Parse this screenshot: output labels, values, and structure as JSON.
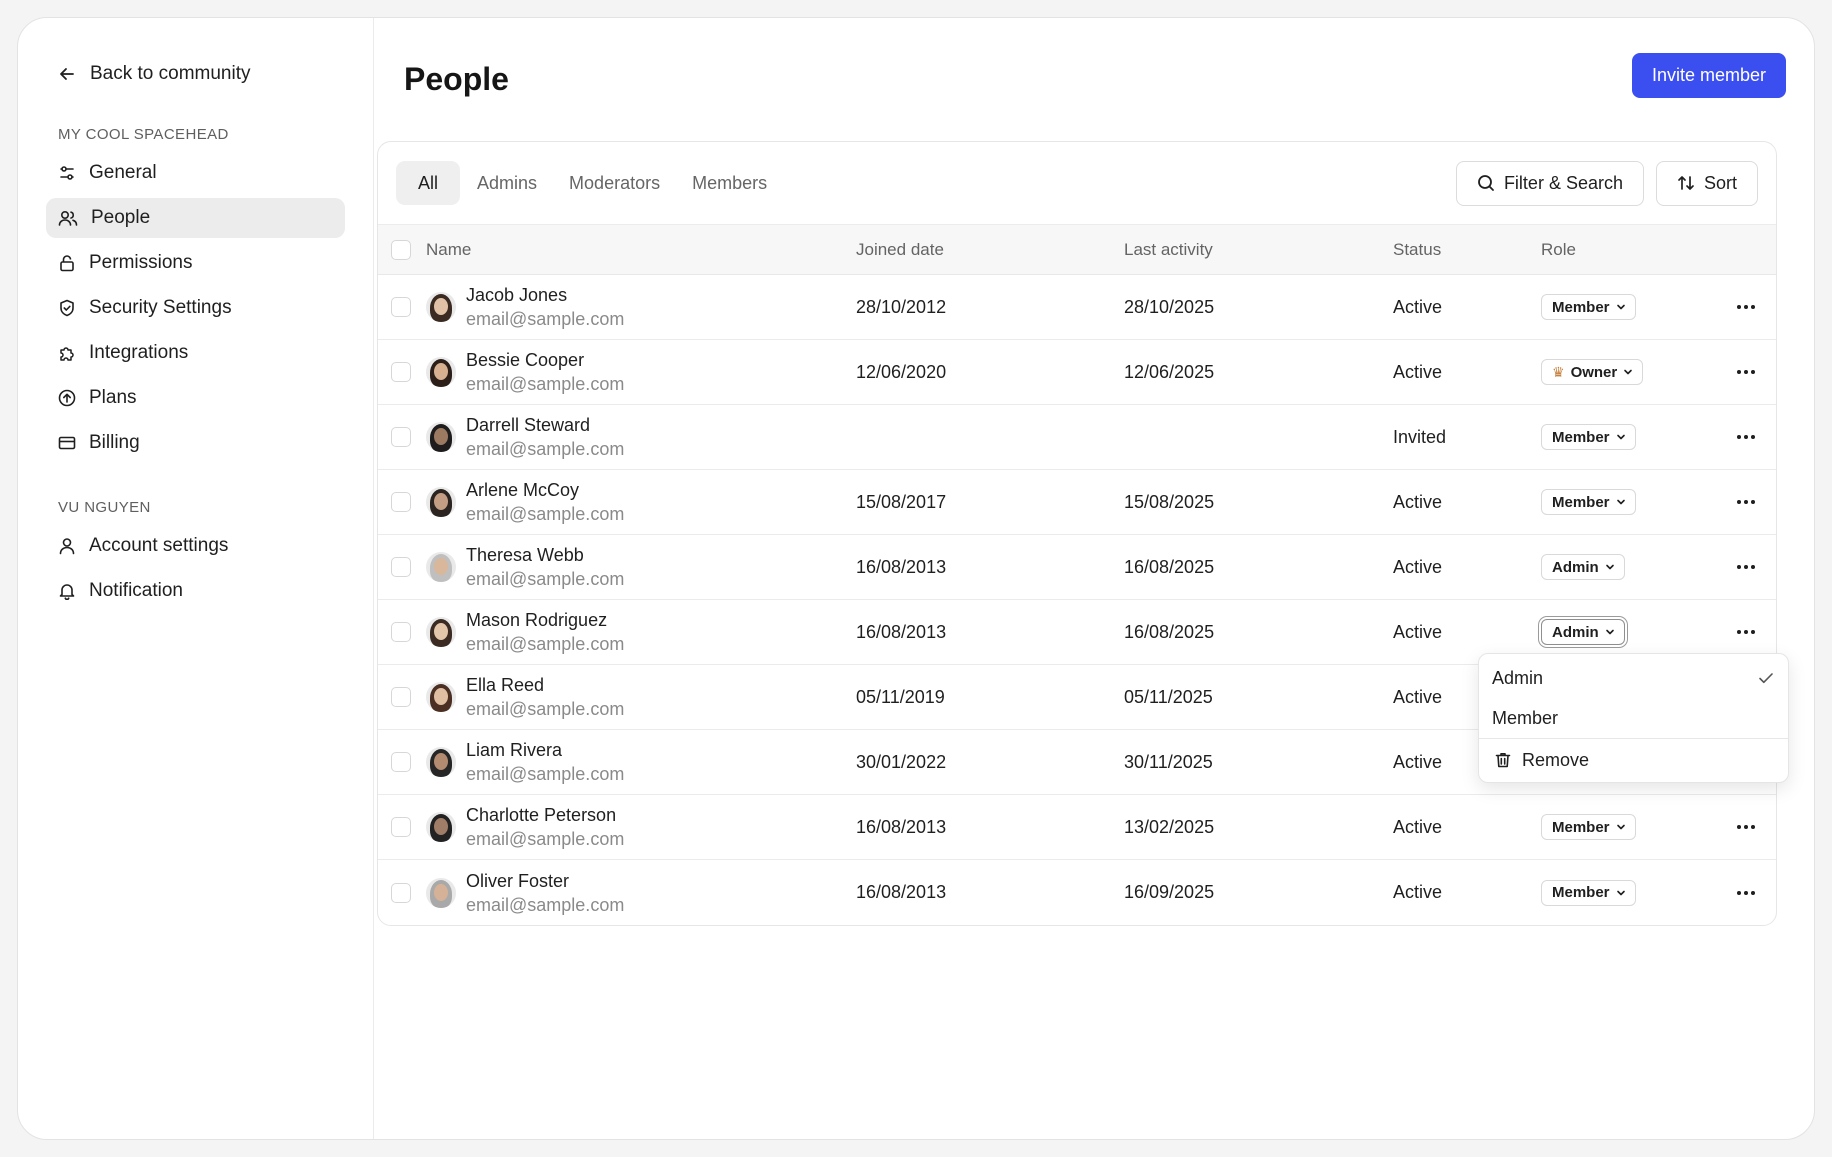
{
  "sidebar": {
    "back_label": "Back to community",
    "section1_title": "MY COOL SPACEHEAD",
    "items": [
      {
        "label": "General",
        "icon": "sliders-icon"
      },
      {
        "label": "People",
        "icon": "people-icon",
        "active": true
      },
      {
        "label": "Permissions",
        "icon": "lock-icon"
      },
      {
        "label": "Security Settings",
        "icon": "shield-icon"
      },
      {
        "label": "Integrations",
        "icon": "puzzle-icon"
      },
      {
        "label": "Plans",
        "icon": "arrow-up-circle-icon"
      },
      {
        "label": "Billing",
        "icon": "credit-card-icon"
      }
    ],
    "section2_title": "VU NGUYEN",
    "items2": [
      {
        "label": "Account settings",
        "icon": "user-icon"
      },
      {
        "label": "Notification",
        "icon": "bell-icon"
      }
    ]
  },
  "header": {
    "title": "People",
    "invite_label": "Invite member"
  },
  "tabs": [
    "All",
    "Admins",
    "Moderators",
    "Members"
  ],
  "toolbar": {
    "filter_label": "Filter & Search",
    "sort_label": "Sort"
  },
  "table": {
    "columns": [
      "Name",
      "Joined date",
      "Last activity",
      "Status",
      "Role"
    ],
    "rows": [
      {
        "name": "Jacob Jones",
        "email": "email@sample.com",
        "joined": "28/10/2012",
        "last": "28/10/2025",
        "status": "Active",
        "role": "Member"
      },
      {
        "name": "Bessie Cooper",
        "email": "email@sample.com",
        "joined": "12/06/2020",
        "last": "12/06/2025",
        "status": "Active",
        "role": "Owner"
      },
      {
        "name": "Darrell Steward",
        "email": "email@sample.com",
        "joined": "",
        "last": "",
        "status": "Invited",
        "role": "Member"
      },
      {
        "name": "Arlene McCoy",
        "email": "email@sample.com",
        "joined": "15/08/2017",
        "last": "15/08/2025",
        "status": "Active",
        "role": "Member"
      },
      {
        "name": "Theresa Webb",
        "email": "email@sample.com",
        "joined": "16/08/2013",
        "last": "16/08/2025",
        "status": "Active",
        "role": "Admin"
      },
      {
        "name": "Mason Rodriguez",
        "email": "email@sample.com",
        "joined": "16/08/2013",
        "last": "16/08/2025",
        "status": "Active",
        "role": "Admin"
      },
      {
        "name": "Ella Reed",
        "email": "email@sample.com",
        "joined": "05/11/2019",
        "last": "05/11/2025",
        "status": "Active",
        "role": ""
      },
      {
        "name": "Liam Rivera",
        "email": "email@sample.com",
        "joined": "30/01/2022",
        "last": "30/11/2025",
        "status": "Active",
        "role": ""
      },
      {
        "name": "Charlotte Peterson",
        "email": "email@sample.com",
        "joined": "16/08/2013",
        "last": "13/02/2025",
        "status": "Active",
        "role": "Member"
      },
      {
        "name": "Oliver Foster",
        "email": "email@sample.com",
        "joined": "16/08/2013",
        "last": "16/09/2025",
        "status": "Active",
        "role": "Member"
      }
    ]
  },
  "role_menu": {
    "options": [
      "Admin",
      "Member"
    ],
    "selected": "Admin",
    "remove_label": "Remove"
  },
  "colors": {
    "accent": "#3b4ef0",
    "active_nav_bg": "#ececec",
    "owner_crown": "#c5813f"
  }
}
